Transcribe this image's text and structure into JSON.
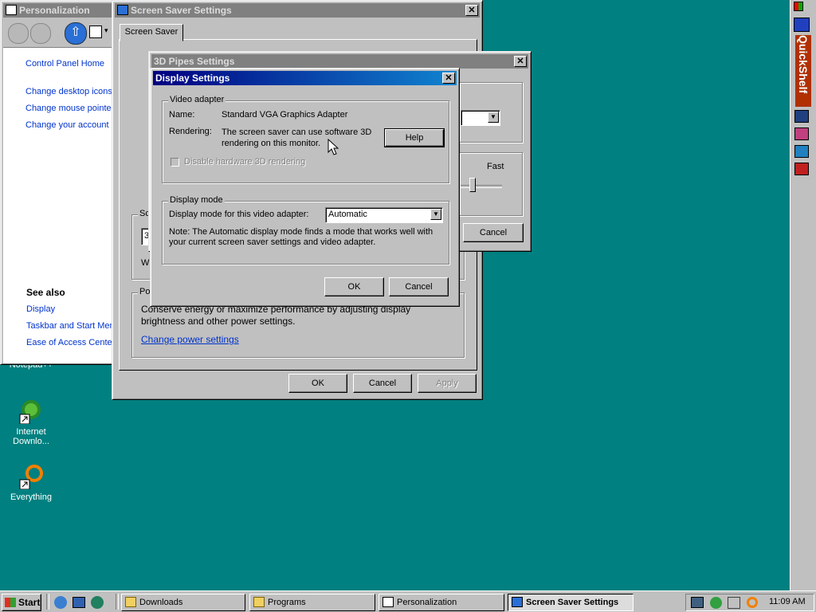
{
  "desktop": {
    "icons": [
      {
        "label": "Notepad++"
      },
      {
        "label": "Internet Downlo..."
      },
      {
        "label": "Everything"
      }
    ]
  },
  "personalization": {
    "title": "Personalization",
    "nav": [
      "Control Panel Home",
      "Change desktop icons",
      "Change mouse pointers",
      "Change your account p"
    ],
    "see_also_heading": "See also",
    "see_also": [
      "Display",
      "Taskbar and Start Menu",
      "Ease of Access Center"
    ]
  },
  "screensaver_settings": {
    "title": "Screen Saver Settings",
    "tab": "Screen Saver",
    "screensaver_group_label": "Sc",
    "screensaver_value": "3",
    "wait_label": "W",
    "power_group_label": "Po",
    "power_text": "Conserve energy or maximize performance by adjusting display brightness and other power settings.",
    "power_link": "Change power settings",
    "ok": "OK",
    "cancel": "Cancel",
    "apply": "Apply"
  },
  "pipes_settings": {
    "title": "3D Pipes Settings",
    "fast_label": "Fast",
    "cancel": "Cancel"
  },
  "display_settings": {
    "title": "Display Settings",
    "video_adapter_group": "Video adapter",
    "name_label": "Name:",
    "name_value": "Standard VGA Graphics Adapter",
    "rendering_label": "Rendering:",
    "rendering_value": "The screen saver can use software 3D rendering on this monitor.",
    "help": "Help",
    "disable_hw_label": "Disable hardware 3D rendering",
    "display_mode_group": "Display mode",
    "display_mode_label": "Display mode for this video adapter:",
    "display_mode_value": "Automatic",
    "note": "Note: The Automatic display mode finds a mode that works well with your current screen saver settings and video adapter.",
    "ok": "OK",
    "cancel": "Cancel"
  },
  "quickshelf": {
    "label": "QuickShelf"
  },
  "taskbar": {
    "start": "Start",
    "buttons": [
      "Downloads",
      "Programs",
      "Personalization",
      "Screen Saver Settings"
    ],
    "clock": "11:09 AM"
  }
}
